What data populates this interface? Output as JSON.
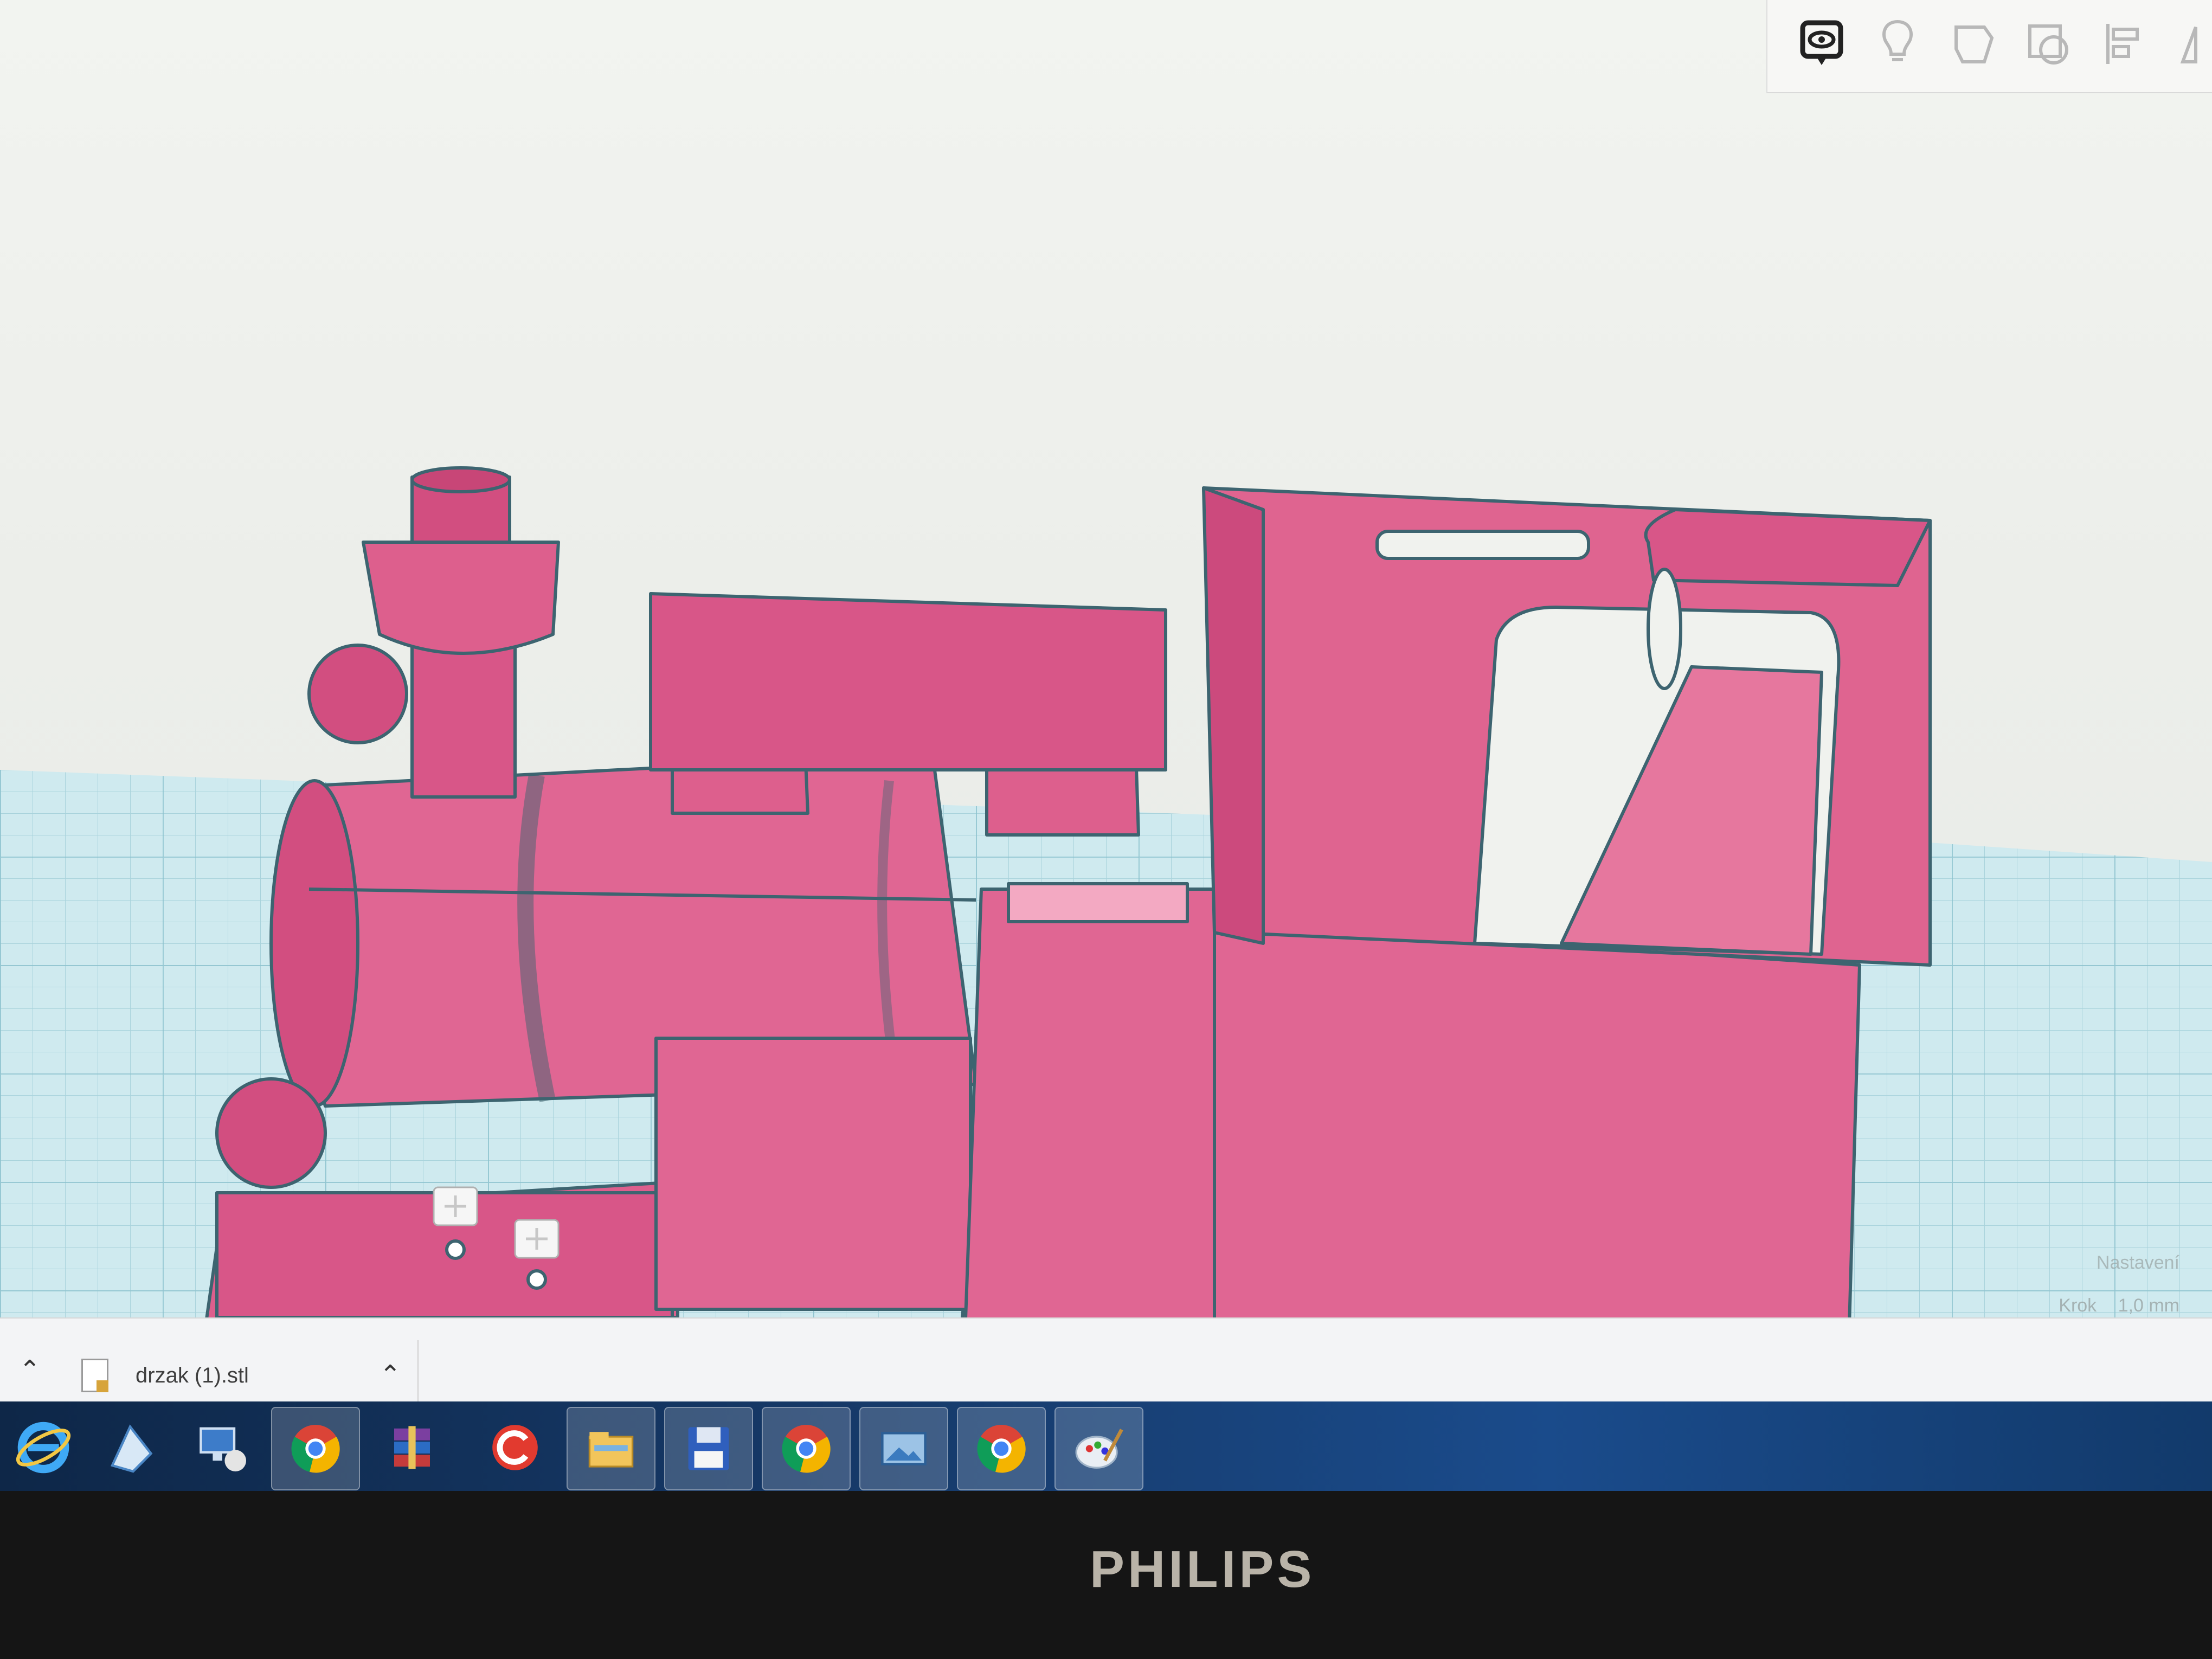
{
  "toolbar": {
    "tools": [
      {
        "icon": "comment-eye-icon"
      },
      {
        "icon": "lightbulb-icon"
      },
      {
        "icon": "note-shape-icon"
      },
      {
        "icon": "shape-outline-icon"
      },
      {
        "icon": "align-icon"
      },
      {
        "icon": "mirror-icon"
      }
    ]
  },
  "viewport": {
    "settings_label": "Nastavení",
    "step_label": "Krok",
    "step_value": "1,0 mm"
  },
  "downloads": {
    "file_name": "drzak (1).stl"
  },
  "taskbar": {
    "apps": [
      {
        "icon": "internet-explorer-icon"
      },
      {
        "icon": "notepad-icon"
      },
      {
        "icon": "remote-desktop-icon"
      },
      {
        "icon": "chrome-icon",
        "active": true
      },
      {
        "icon": "winrar-icon"
      },
      {
        "icon": "ccleaner-icon"
      },
      {
        "icon": "file-explorer-icon",
        "active": true
      },
      {
        "icon": "floppy-disk-icon",
        "active": true
      },
      {
        "icon": "chrome-icon",
        "active": true
      },
      {
        "icon": "photo-viewer-icon",
        "active": true
      },
      {
        "icon": "chrome-icon",
        "active": true
      },
      {
        "icon": "paint-icon",
        "active": true
      }
    ]
  },
  "monitor": {
    "brand": "PHILIPS"
  },
  "colors": {
    "model_pink": "#e05a8a",
    "grid_cyan": "#bfe3ea",
    "taskbar_blue": "#163a6a"
  }
}
